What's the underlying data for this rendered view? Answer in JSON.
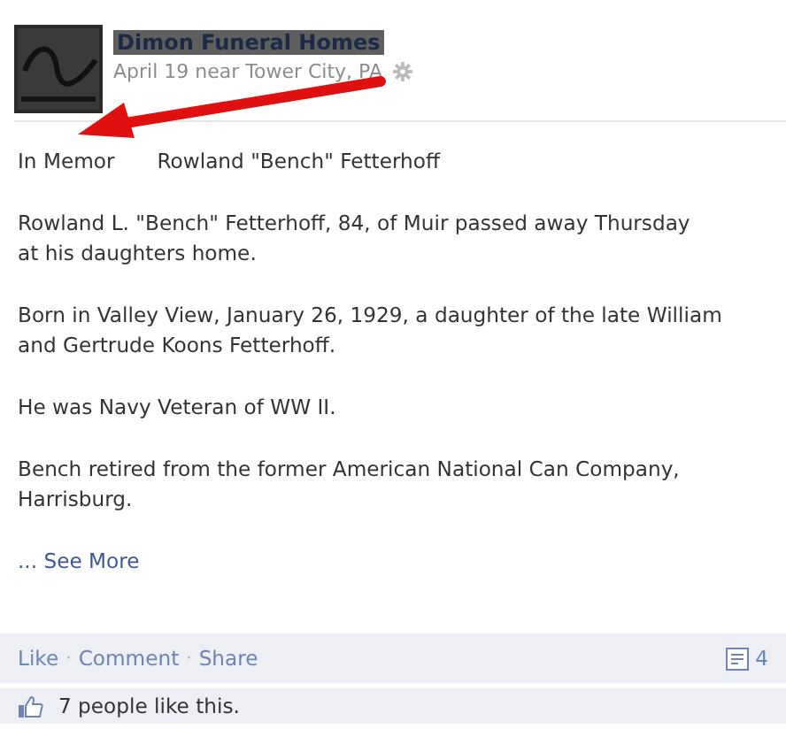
{
  "post": {
    "page_name": "Dimon Funeral Homes",
    "meta": "April 19 near Tower City, PA",
    "intro": [
      "In Memor",
      "Rowland \"Bench\" Fetterhoff"
    ],
    "paragraphs": [
      [
        "Rowland L. \"Bench\" Fetterhoff, 84, of Muir passed away Thursday",
        "at his daughters home."
      ],
      [
        "Born in Valley View, January 26, 1929, a daughter of the late William",
        "and Gertrude Koons Fetterhoff."
      ],
      [
        "He was Navy Veteran of WW II."
      ],
      [
        "Bench retired from the former American National Can Company,",
        "Harrisburg."
      ]
    ],
    "see_more": "... See More"
  },
  "actions": {
    "links": [
      "Like",
      "Comment",
      "Share"
    ],
    "separator": "·",
    "comment_count": "4"
  },
  "likes": {
    "text": "7 people like this."
  }
}
